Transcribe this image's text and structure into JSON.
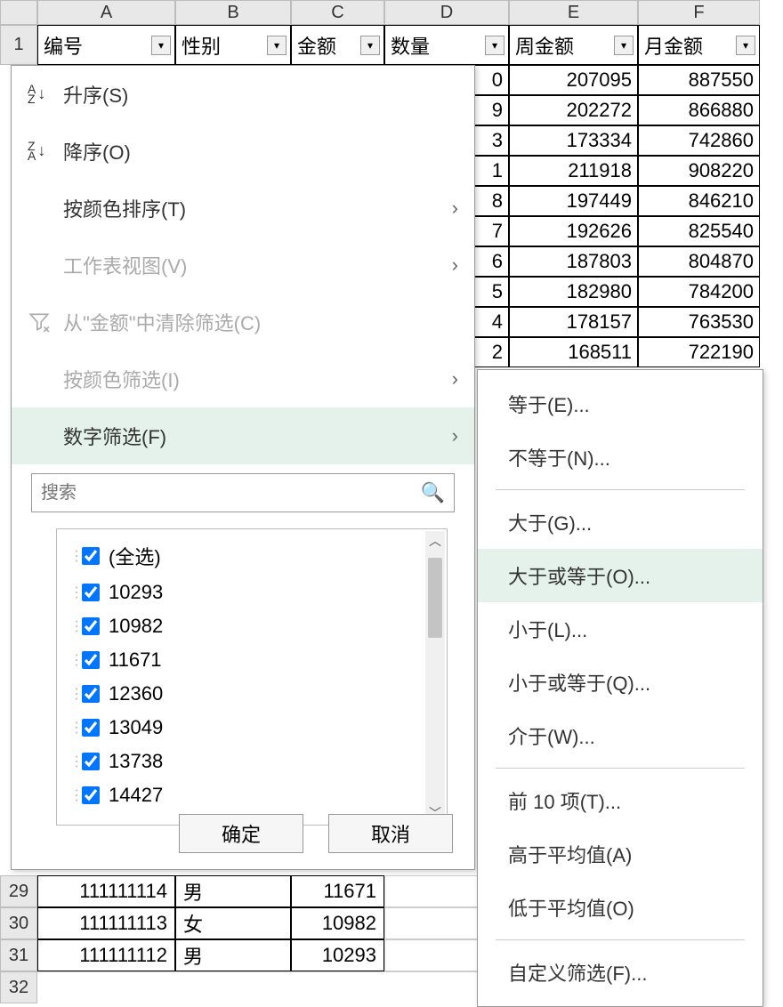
{
  "columns": [
    "A",
    "B",
    "C",
    "D",
    "E",
    "F"
  ],
  "row1_headers": {
    "A": "编号",
    "B": "性别",
    "C": "金额",
    "D": "数量",
    "E": "周金额",
    "F": "月金额"
  },
  "row_label_1": "1",
  "visible_data": [
    {
      "D": "0",
      "E": "207095",
      "F": "887550"
    },
    {
      "D": "9",
      "E": "202272",
      "F": "866880"
    },
    {
      "D": "3",
      "E": "173334",
      "F": "742860"
    },
    {
      "D": "1",
      "E": "211918",
      "F": "908220"
    },
    {
      "D": "8",
      "E": "197449",
      "F": "846210"
    },
    {
      "D": "7",
      "E": "192626",
      "F": "825540"
    },
    {
      "D": "6",
      "E": "187803",
      "F": "804870"
    },
    {
      "D": "5",
      "E": "182980",
      "F": "784200"
    },
    {
      "D": "4",
      "E": "178157",
      "F": "763530"
    },
    {
      "D": "2",
      "E": "168511",
      "F": "722190"
    }
  ],
  "bottom_rows": [
    {
      "num": "29",
      "A": "111111114",
      "B": "男",
      "C": "11671"
    },
    {
      "num": "30",
      "A": "111111113",
      "B": "女",
      "C": "10982"
    },
    {
      "num": "31",
      "A": "111111112",
      "B": "男",
      "C": "10293"
    },
    {
      "num": "32",
      "A": "",
      "B": "",
      "C": ""
    }
  ],
  "filter_panel": {
    "sort_asc": "升序(S)",
    "sort_desc": "降序(O)",
    "sort_by_color": "按颜色排序(T)",
    "sheet_view": "工作表视图(V)",
    "clear_filter": "从\"金额\"中清除筛选(C)",
    "filter_by_color": "按颜色筛选(I)",
    "number_filter": "数字筛选(F)",
    "search_placeholder": "搜索",
    "check_items": [
      "(全选)",
      "10293",
      "10982",
      "11671",
      "12360",
      "13049",
      "13738",
      "14427"
    ],
    "ok": "确定",
    "cancel": "取消"
  },
  "number_filter_submenu": {
    "equals": "等于(E)...",
    "not_equals": "不等于(N)...",
    "greater_than": "大于(G)...",
    "greater_equal": "大于或等于(O)...",
    "less_than": "小于(L)...",
    "less_equal": "小于或等于(Q)...",
    "between": "介于(W)...",
    "top10": "前 10 项(T)...",
    "above_avg": "高于平均值(A)",
    "below_avg": "低于平均值(O)",
    "custom": "自定义筛选(F)..."
  }
}
